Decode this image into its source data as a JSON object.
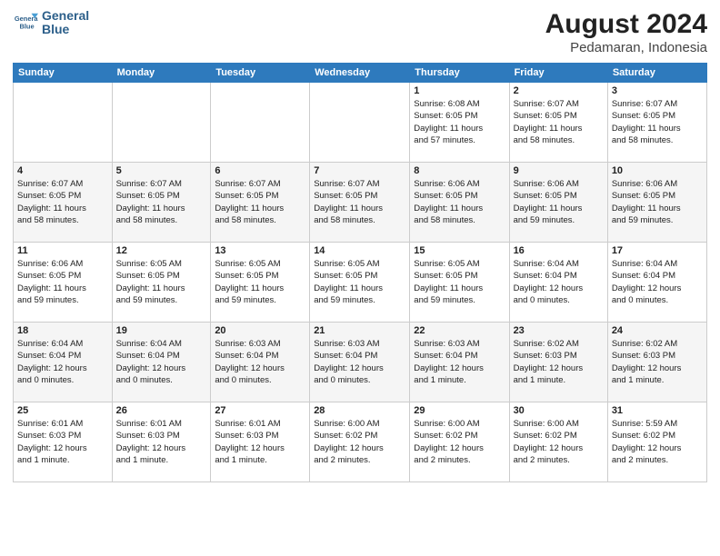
{
  "title": "August 2024",
  "subtitle": "Pedamaran, Indonesia",
  "logo": {
    "line1": "General",
    "line2": "Blue"
  },
  "headers": [
    "Sunday",
    "Monday",
    "Tuesday",
    "Wednesday",
    "Thursday",
    "Friday",
    "Saturday"
  ],
  "weeks": [
    [
      {
        "day": "",
        "info": ""
      },
      {
        "day": "",
        "info": ""
      },
      {
        "day": "",
        "info": ""
      },
      {
        "day": "",
        "info": ""
      },
      {
        "day": "1",
        "info": "Sunrise: 6:08 AM\nSunset: 6:05 PM\nDaylight: 11 hours\nand 57 minutes."
      },
      {
        "day": "2",
        "info": "Sunrise: 6:07 AM\nSunset: 6:05 PM\nDaylight: 11 hours\nand 58 minutes."
      },
      {
        "day": "3",
        "info": "Sunrise: 6:07 AM\nSunset: 6:05 PM\nDaylight: 11 hours\nand 58 minutes."
      }
    ],
    [
      {
        "day": "4",
        "info": "Sunrise: 6:07 AM\nSunset: 6:05 PM\nDaylight: 11 hours\nand 58 minutes."
      },
      {
        "day": "5",
        "info": "Sunrise: 6:07 AM\nSunset: 6:05 PM\nDaylight: 11 hours\nand 58 minutes."
      },
      {
        "day": "6",
        "info": "Sunrise: 6:07 AM\nSunset: 6:05 PM\nDaylight: 11 hours\nand 58 minutes."
      },
      {
        "day": "7",
        "info": "Sunrise: 6:07 AM\nSunset: 6:05 PM\nDaylight: 11 hours\nand 58 minutes."
      },
      {
        "day": "8",
        "info": "Sunrise: 6:06 AM\nSunset: 6:05 PM\nDaylight: 11 hours\nand 58 minutes."
      },
      {
        "day": "9",
        "info": "Sunrise: 6:06 AM\nSunset: 6:05 PM\nDaylight: 11 hours\nand 59 minutes."
      },
      {
        "day": "10",
        "info": "Sunrise: 6:06 AM\nSunset: 6:05 PM\nDaylight: 11 hours\nand 59 minutes."
      }
    ],
    [
      {
        "day": "11",
        "info": "Sunrise: 6:06 AM\nSunset: 6:05 PM\nDaylight: 11 hours\nand 59 minutes."
      },
      {
        "day": "12",
        "info": "Sunrise: 6:05 AM\nSunset: 6:05 PM\nDaylight: 11 hours\nand 59 minutes."
      },
      {
        "day": "13",
        "info": "Sunrise: 6:05 AM\nSunset: 6:05 PM\nDaylight: 11 hours\nand 59 minutes."
      },
      {
        "day": "14",
        "info": "Sunrise: 6:05 AM\nSunset: 6:05 PM\nDaylight: 11 hours\nand 59 minutes."
      },
      {
        "day": "15",
        "info": "Sunrise: 6:05 AM\nSunset: 6:05 PM\nDaylight: 11 hours\nand 59 minutes."
      },
      {
        "day": "16",
        "info": "Sunrise: 6:04 AM\nSunset: 6:04 PM\nDaylight: 12 hours\nand 0 minutes."
      },
      {
        "day": "17",
        "info": "Sunrise: 6:04 AM\nSunset: 6:04 PM\nDaylight: 12 hours\nand 0 minutes."
      }
    ],
    [
      {
        "day": "18",
        "info": "Sunrise: 6:04 AM\nSunset: 6:04 PM\nDaylight: 12 hours\nand 0 minutes."
      },
      {
        "day": "19",
        "info": "Sunrise: 6:04 AM\nSunset: 6:04 PM\nDaylight: 12 hours\nand 0 minutes."
      },
      {
        "day": "20",
        "info": "Sunrise: 6:03 AM\nSunset: 6:04 PM\nDaylight: 12 hours\nand 0 minutes."
      },
      {
        "day": "21",
        "info": "Sunrise: 6:03 AM\nSunset: 6:04 PM\nDaylight: 12 hours\nand 0 minutes."
      },
      {
        "day": "22",
        "info": "Sunrise: 6:03 AM\nSunset: 6:04 PM\nDaylight: 12 hours\nand 1 minute."
      },
      {
        "day": "23",
        "info": "Sunrise: 6:02 AM\nSunset: 6:03 PM\nDaylight: 12 hours\nand 1 minute."
      },
      {
        "day": "24",
        "info": "Sunrise: 6:02 AM\nSunset: 6:03 PM\nDaylight: 12 hours\nand 1 minute."
      }
    ],
    [
      {
        "day": "25",
        "info": "Sunrise: 6:01 AM\nSunset: 6:03 PM\nDaylight: 12 hours\nand 1 minute."
      },
      {
        "day": "26",
        "info": "Sunrise: 6:01 AM\nSunset: 6:03 PM\nDaylight: 12 hours\nand 1 minute."
      },
      {
        "day": "27",
        "info": "Sunrise: 6:01 AM\nSunset: 6:03 PM\nDaylight: 12 hours\nand 1 minute."
      },
      {
        "day": "28",
        "info": "Sunrise: 6:00 AM\nSunset: 6:02 PM\nDaylight: 12 hours\nand 2 minutes."
      },
      {
        "day": "29",
        "info": "Sunrise: 6:00 AM\nSunset: 6:02 PM\nDaylight: 12 hours\nand 2 minutes."
      },
      {
        "day": "30",
        "info": "Sunrise: 6:00 AM\nSunset: 6:02 PM\nDaylight: 12 hours\nand 2 minutes."
      },
      {
        "day": "31",
        "info": "Sunrise: 5:59 AM\nSunset: 6:02 PM\nDaylight: 12 hours\nand 2 minutes."
      }
    ]
  ]
}
